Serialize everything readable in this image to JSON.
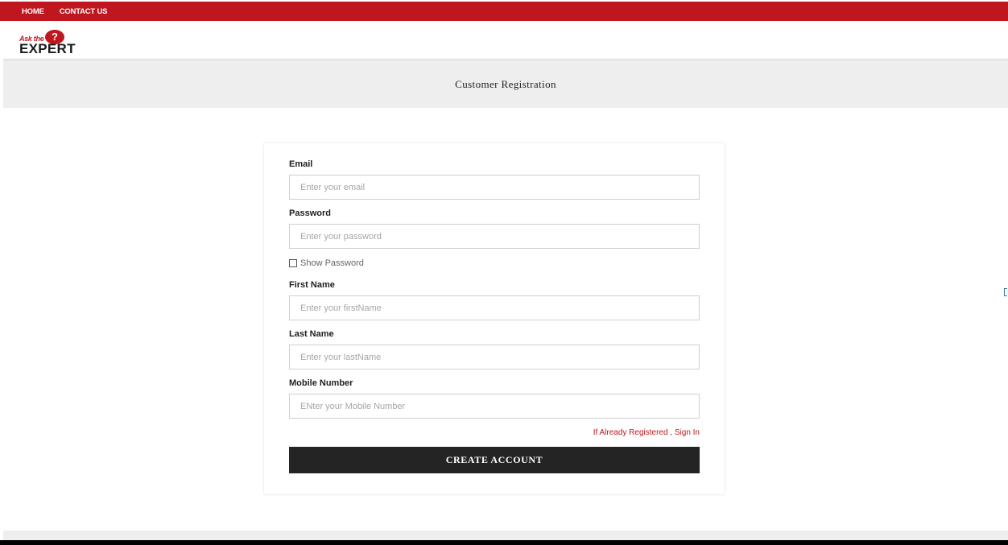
{
  "nav": {
    "home_label": "HOME",
    "contact_label": "CONTACT US"
  },
  "logo": {
    "line1": "Ask the",
    "qmark": "?",
    "line2": "EXPERT"
  },
  "banner": {
    "title": "Customer Registration"
  },
  "form": {
    "email": {
      "label": "Email",
      "placeholder": "Enter your email",
      "value": ""
    },
    "password": {
      "label": "Password",
      "placeholder": "Enter your password",
      "value": ""
    },
    "show_password_label": "Show Password",
    "first_name": {
      "label": "First Name",
      "placeholder": "Enter your firstName",
      "value": ""
    },
    "last_name": {
      "label": "Last Name",
      "placeholder": "Enter your lastName",
      "value": ""
    },
    "mobile": {
      "label": "Mobile Number",
      "placeholder": "ENter your Mobile Number",
      "value": ""
    },
    "signin_link": "If Already Registered , Sign In",
    "submit_label": "CREATE ACCOUNT"
  },
  "colors": {
    "brand_red": "#c0161e",
    "button_dark": "#242424",
    "banner_bg": "#eeeeee"
  }
}
